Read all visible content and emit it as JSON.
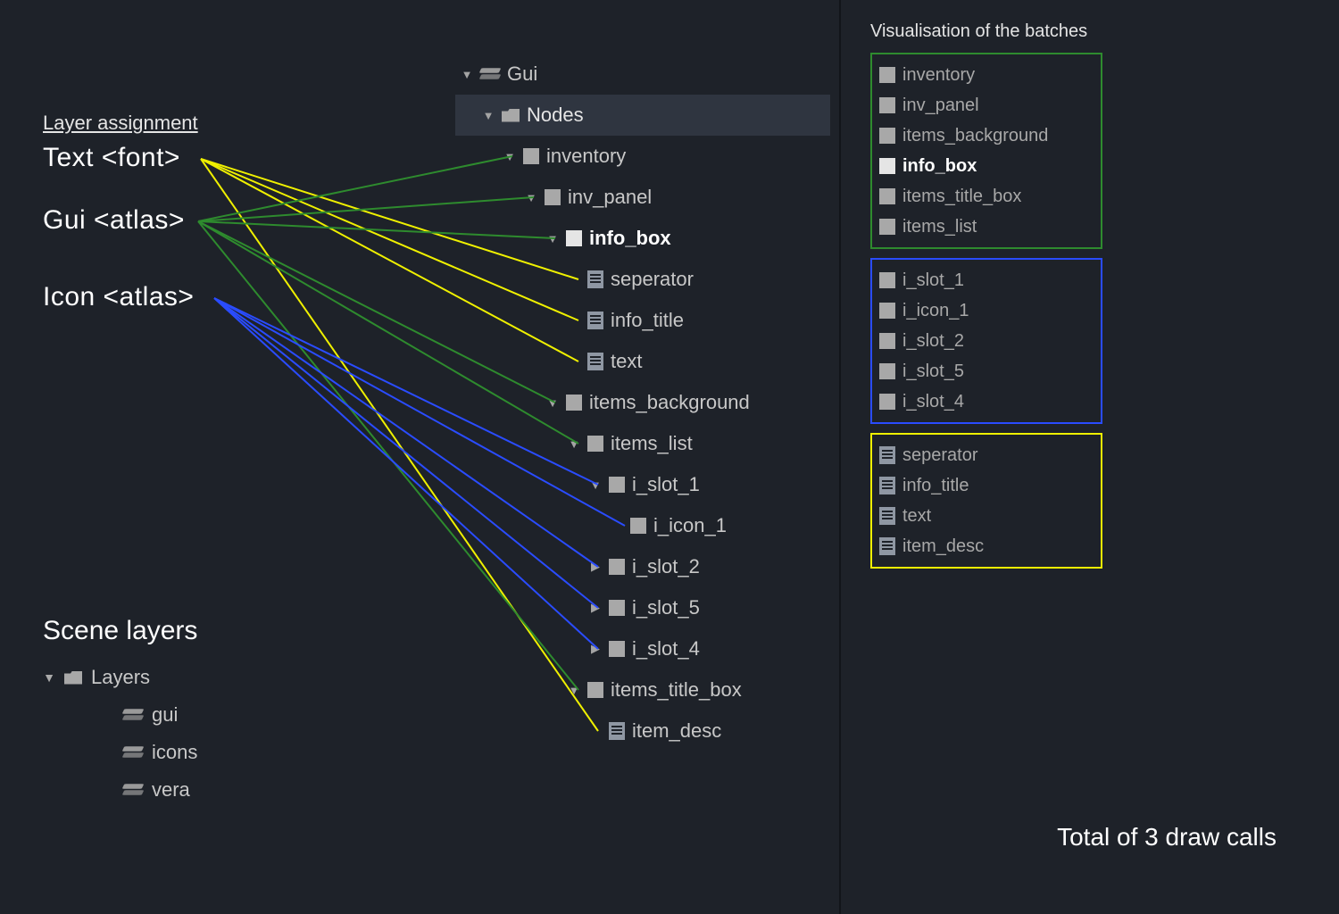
{
  "annotations": {
    "layer_assignment_title": "Layer assignment",
    "layers": {
      "text": "Text <font>",
      "gui": "Gui <atlas>",
      "icon": "Icon <atlas>"
    }
  },
  "scene_layers": {
    "title": "Scene layers",
    "root": "Layers",
    "items": [
      "gui",
      "icons",
      "vera"
    ]
  },
  "tree": {
    "root": "Gui",
    "nodes_label": "Nodes",
    "rows": [
      {
        "label": "inventory",
        "icon": "box",
        "indent": 2,
        "expand": "down"
      },
      {
        "label": "inv_panel",
        "icon": "box",
        "indent": 3,
        "expand": "down"
      },
      {
        "label": "info_box",
        "icon": "boxlt",
        "indent": 4,
        "expand": "down",
        "bold": true
      },
      {
        "label": "seperator",
        "icon": "doc",
        "indent": 5
      },
      {
        "label": "info_title",
        "icon": "doc",
        "indent": 5
      },
      {
        "label": "text",
        "icon": "doc",
        "indent": 5
      },
      {
        "label": "items_background",
        "icon": "box",
        "indent": 4,
        "expand": "down"
      },
      {
        "label": "items_list",
        "icon": "box",
        "indent": 5,
        "expand": "down"
      },
      {
        "label": "i_slot_1",
        "icon": "box",
        "indent": 6,
        "expand": "down"
      },
      {
        "label": "i_icon_1",
        "icon": "box",
        "indent": 7
      },
      {
        "label": "i_slot_2",
        "icon": "box",
        "indent": 6,
        "expand": "right"
      },
      {
        "label": "i_slot_5",
        "icon": "box",
        "indent": 6,
        "expand": "right"
      },
      {
        "label": "i_slot_4",
        "icon": "box",
        "indent": 6,
        "expand": "right"
      },
      {
        "label": "items_title_box",
        "icon": "box",
        "indent": 5,
        "expand": "down"
      },
      {
        "label": "item_desc",
        "icon": "doc",
        "indent": 6
      }
    ]
  },
  "batches": {
    "title": "Visualisation of the batches",
    "groups": [
      {
        "color": "green",
        "rows": [
          {
            "label": "inventory",
            "icon": "box"
          },
          {
            "label": "inv_panel",
            "icon": "box"
          },
          {
            "label": "items_background",
            "icon": "box"
          },
          {
            "label": "info_box",
            "icon": "boxlt",
            "bold": true
          },
          {
            "label": "items_title_box",
            "icon": "box"
          },
          {
            "label": "items_list",
            "icon": "box"
          }
        ]
      },
      {
        "color": "blue",
        "rows": [
          {
            "label": "i_slot_1",
            "icon": "box"
          },
          {
            "label": "i_icon_1",
            "icon": "box"
          },
          {
            "label": "i_slot_2",
            "icon": "box"
          },
          {
            "label": "i_slot_5",
            "icon": "box"
          },
          {
            "label": "i_slot_4",
            "icon": "box"
          }
        ]
      },
      {
        "color": "yellow",
        "rows": [
          {
            "label": "seperator",
            "icon": "doc"
          },
          {
            "label": "info_title",
            "icon": "doc"
          },
          {
            "label": "text",
            "icon": "doc"
          },
          {
            "label": "item_desc",
            "icon": "doc"
          }
        ]
      }
    ],
    "total": "Total of 3 draw calls"
  },
  "colors": {
    "green": "#2e8b2e",
    "blue": "#2a4cff",
    "yellow": "#eff000"
  },
  "lines": {
    "origins": {
      "text": [
        225,
        178
      ],
      "gui": [
        222,
        248
      ],
      "icon": [
        240,
        334
      ]
    },
    "targets": {
      "inventory": [
        574,
        175
      ],
      "inv_panel": [
        598,
        221
      ],
      "info_box": [
        622,
        267
      ],
      "seperator": [
        648,
        313
      ],
      "info_title": [
        648,
        359
      ],
      "text": [
        648,
        405
      ],
      "items_background": [
        622,
        451
      ],
      "items_list": [
        648,
        497
      ],
      "i_slot_1": [
        670,
        543
      ],
      "i_icon_1": [
        700,
        589
      ],
      "i_slot_2": [
        670,
        635
      ],
      "i_slot_5": [
        670,
        681
      ],
      "i_slot_4": [
        670,
        727
      ],
      "items_title_box": [
        648,
        773
      ],
      "item_desc": [
        670,
        819
      ]
    },
    "mapping": {
      "text": [
        "seperator",
        "info_title",
        "text",
        "item_desc"
      ],
      "gui": [
        "inventory",
        "inv_panel",
        "info_box",
        "items_background",
        "items_list",
        "items_title_box"
      ],
      "icon": [
        "i_slot_1",
        "i_icon_1",
        "i_slot_2",
        "i_slot_5",
        "i_slot_4"
      ]
    }
  }
}
